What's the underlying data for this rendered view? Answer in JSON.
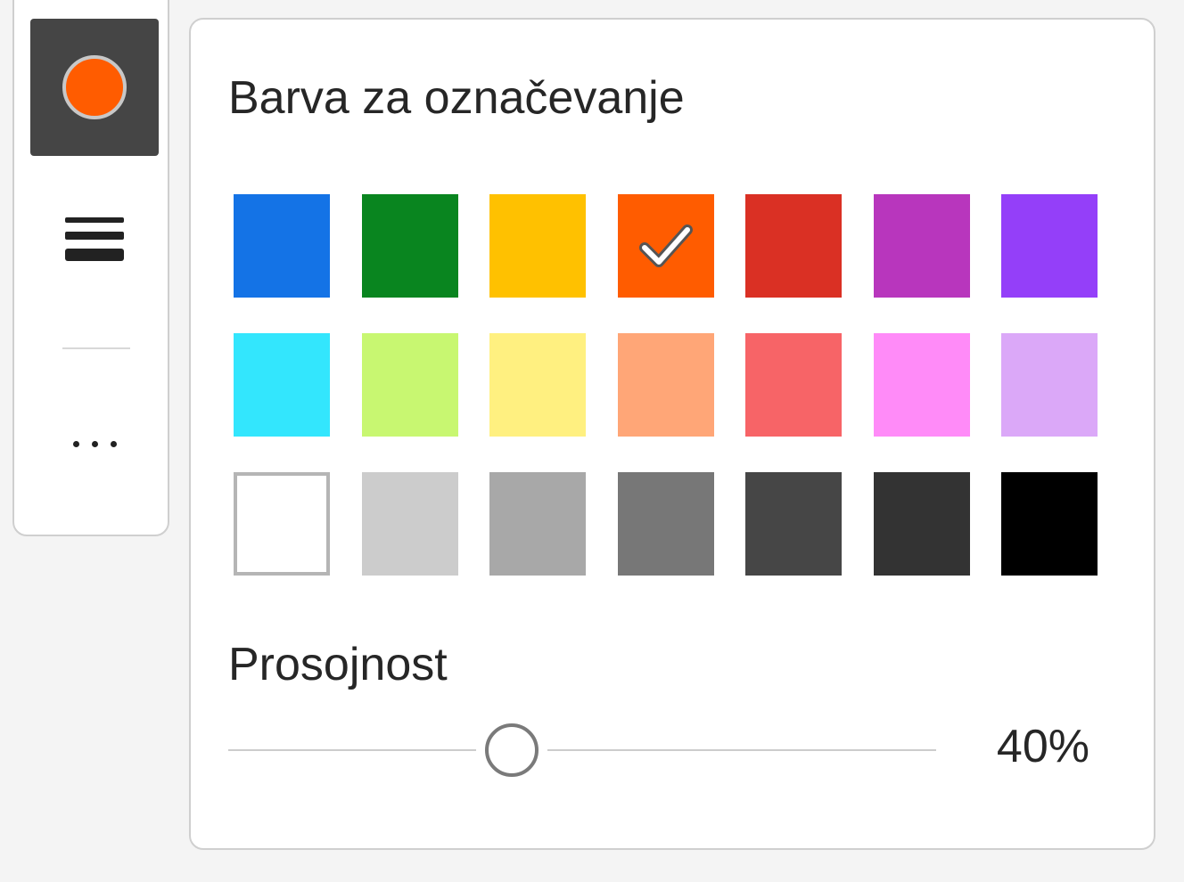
{
  "toolbar": {
    "current_color": "#ff5c00",
    "icons": {
      "color": "color-circle-icon",
      "thickness": "line-thickness-icon",
      "more": "more-dots-icon"
    }
  },
  "color_panel": {
    "title": "Barva za označevanje",
    "selected_color": "#ff5c00",
    "swatches": [
      "#1473e6",
      "#09851f",
      "#ffc100",
      "#ff5c00",
      "#da3024",
      "#b836bd",
      "#943ff9",
      "#33e6fd",
      "#c8f771",
      "#fff080",
      "#ffa677",
      "#f76467",
      "#ff8bf8",
      "#dba8f8",
      "#ffffff",
      "#cccccc",
      "#a8a8a8",
      "#777777",
      "#464646",
      "#333333",
      "#000000"
    ],
    "opacity": {
      "label": "Prosojnost",
      "value": 40,
      "value_text": "40%"
    }
  }
}
